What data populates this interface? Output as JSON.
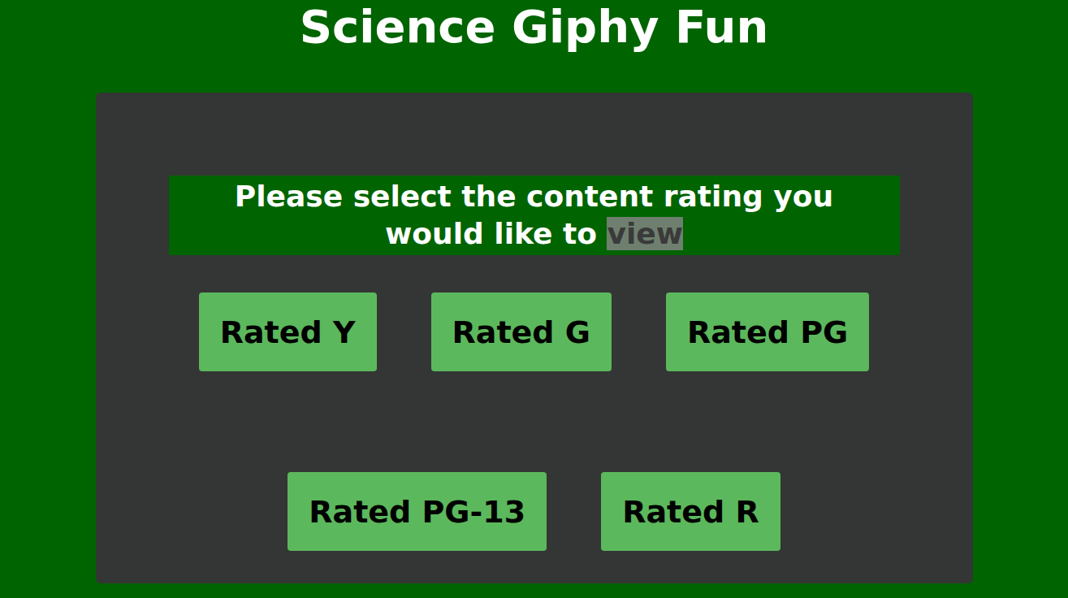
{
  "title": "Science Giphy Fun",
  "prompt": [
    {
      "text": "Please select the content rating you would like to",
      "selected": false
    },
    {
      "text": "view",
      "selected": true
    }
  ],
  "ratings": [
    {
      "label": "Rated Y"
    },
    {
      "label": "Rated G"
    },
    {
      "label": "Rated PG"
    },
    {
      "label": "Rated PG-13"
    },
    {
      "label": "Rated R"
    }
  ]
}
